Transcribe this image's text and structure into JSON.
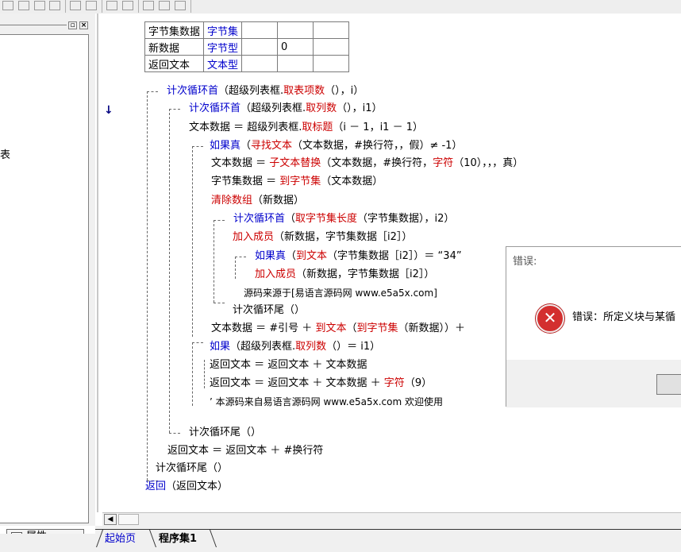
{
  "colors": {
    "keyword": "#0000cc",
    "function": "#cc0000",
    "comment": "#008000",
    "error_icon": "#d32f2f"
  },
  "left_panel": {
    "tree_fragment": "表",
    "prop_tab_label": "属性",
    "prop_icon": "properties-icon"
  },
  "var_table": [
    [
      "字节集数据",
      "字节集",
      "",
      "",
      ""
    ],
    [
      "新数据",
      "字节型",
      "",
      "0",
      ""
    ],
    [
      "返回文本",
      "文本型",
      "",
      "",
      ""
    ]
  ],
  "code": {
    "l1a": "计次循环首",
    "l1b": "（超级列表框.",
    "l1c": "取表项数",
    "l1d": "（），i）",
    "l2a": "计次循环首",
    "l2b": "（超级列表框.",
    "l2c": "取列数",
    "l2d": "（），i1）",
    "l3a": "文本数据 ＝ 超级列表框.",
    "l3b": "取标题",
    "l3c": "（i － 1，i1 － 1）",
    "l4a": "如果真",
    "l4b": "（",
    "l4c": "寻找文本",
    "l4d": "（文本数据，#换行符，，假）≠ -1）",
    "l5a": "文本数据 ＝ ",
    "l5b": "子文本替换",
    "l5c": "（文本数据，#换行符，",
    "l5d": "字符",
    "l5e": "（10），，，真）",
    "l6a": "字节集数据 ＝ ",
    "l6b": "到字节集",
    "l6c": "（文本数据）",
    "l7a": "清除数组",
    "l7b": "（新数据）",
    "l8a": "计次循环首",
    "l8b": "（",
    "l8c": "取字节集长度",
    "l8d": "（字节集数据），i2）",
    "l9a": "加入成员",
    "l9b": "（新数据，字节集数据［i2］）",
    "l10a": "如果真",
    "l10b": "（",
    "l10c": "到文本",
    "l10d": "（字节集数据［i2］）＝ “34”",
    "l11a": "加入成员",
    "l11b": "（新数据，字节集数据［i2］）",
    "l12": "源码来源于[易语言源码网 www.e5a5x.com]",
    "l13": "计次循环尾（）",
    "l14a": "文本数据 ＝ #引号 ＋ ",
    "l14b": "到文本",
    "l14c": "（",
    "l14d": "到字节集",
    "l14e": "（新数据））＋",
    "l15a": "如果",
    "l15b": "（超级列表框.",
    "l15c": "取列数",
    "l15d": "（）＝ i1）",
    "l16": "返回文本 ＝ 返回文本 ＋ 文本数据",
    "l17a": "返回文本 ＝ 返回文本 ＋ 文本数据 ＋ ",
    "l17b": "字符",
    "l17c": "（9）",
    "l18": "’ 本源码来自易语言源码网 www.e5a5x.com  欢迎使用",
    "l19": "计次循环尾（）",
    "l20": "返回文本 ＝ 返回文本 ＋ #换行符",
    "l21": "计次循环尾（）",
    "l22a": "返回",
    "l22b": "（返回文本）"
  },
  "dialog": {
    "title": "错误:",
    "message": "错误：所定义块与某循",
    "icon": "error-icon"
  },
  "tabs": {
    "start": "起始页",
    "program": "程序集1"
  }
}
